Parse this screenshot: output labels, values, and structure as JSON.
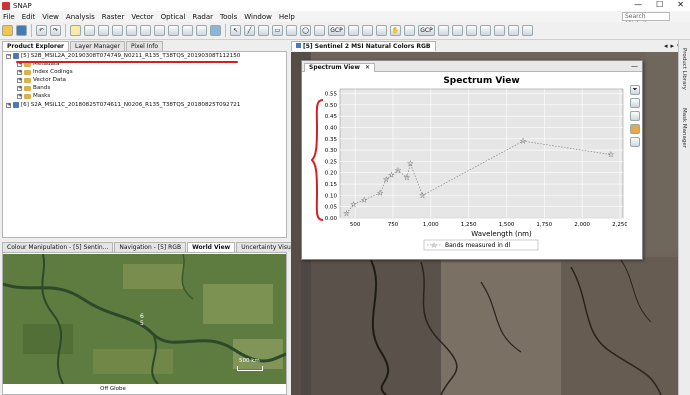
{
  "app": {
    "title": "SNAP"
  },
  "window_controls": {
    "minimize": "—",
    "maximize": "☐",
    "close": "✕"
  },
  "menu": [
    "File",
    "Edit",
    "View",
    "Analysis",
    "Raster",
    "Vector",
    "Optical",
    "Radar",
    "Tools",
    "Window",
    "Help"
  ],
  "search": {
    "placeholder": "Search (Ctrl+I)"
  },
  "toolbar": {
    "gcp1": "GCP",
    "gcp2": "GCP"
  },
  "left_top_tabs": [
    "Product Explorer",
    "Layer Manager",
    "Pixel Info"
  ],
  "tree": [
    {
      "level": 0,
      "expand": "−",
      "kind": "prod",
      "label": "[5] S2B_MSIL2A_20190308T074749_N0211_R135_T38TQS_20190308T112150"
    },
    {
      "level": 1,
      "expand": "+",
      "kind": "fold",
      "label": "Metadata"
    },
    {
      "level": 1,
      "expand": "+",
      "kind": "fold",
      "label": "Index Codings"
    },
    {
      "level": 1,
      "expand": "+",
      "kind": "fold",
      "label": "Vector Data"
    },
    {
      "level": 1,
      "expand": "+",
      "kind": "fold",
      "label": "Bands"
    },
    {
      "level": 1,
      "expand": "+",
      "kind": "fold",
      "label": "Masks"
    },
    {
      "level": 0,
      "expand": "+",
      "kind": "prod",
      "label": "[6] S2A_MSIL1C_20180825T074611_N0206_R135_T38TQS_20180825T092721"
    }
  ],
  "left_bottom_tabs": [
    "Colour Manipulation - [5] Sentin...",
    "Navigation - [5] RGB",
    "World View",
    "Uncertainty Visualisation"
  ],
  "world_view": {
    "labels": [
      "6",
      "5"
    ],
    "scale": "500 km",
    "status": "Off Globe"
  },
  "image_view_tab": "[5] Sentinel 2 MSI Natural Colors RGB",
  "spectrum_tab": "Spectrum View",
  "right_strip": [
    "Product Library",
    "Mask Manager"
  ],
  "chart_data": {
    "type": "scatter",
    "title": "Spectrum View",
    "xlabel": "Wavelength (nm)",
    "ylabel": "",
    "xlim": [
      400,
      2270
    ],
    "ylim": [
      0,
      0.57
    ],
    "xticks": [
      500,
      750,
      1000,
      1250,
      1500,
      1750,
      2000,
      2250
    ],
    "xtick_labels": [
      "500",
      "750",
      "1,000",
      "1,250",
      "1,500",
      "1,750",
      "2,000",
      "2,250"
    ],
    "yticks": [
      0,
      0.05,
      0.1,
      0.15,
      0.2,
      0.25,
      0.3,
      0.35,
      0.4,
      0.45,
      0.5,
      0.55
    ],
    "ytick_labels": [
      "0.00",
      "0.05",
      "0.10",
      "0.15",
      "0.20",
      "0.25",
      "0.30",
      "0.35",
      "0.40",
      "0.45",
      "0.50",
      "0.55"
    ],
    "grid": true,
    "legend": "bottom",
    "series": [
      {
        "name": "Bands measured in dl",
        "x": [
          443,
          490,
          560,
          665,
          705,
          740,
          783,
          842,
          865,
          945,
          1610,
          2190
        ],
        "y": [
          0.02,
          0.06,
          0.08,
          0.11,
          0.17,
          0.19,
          0.21,
          0.18,
          0.24,
          0.1,
          0.34,
          0.28
        ]
      }
    ]
  },
  "colors": {
    "annotation_red": "#d62020",
    "plot_bg": "#e6e6e6",
    "active_tab": "#ffffff"
  }
}
